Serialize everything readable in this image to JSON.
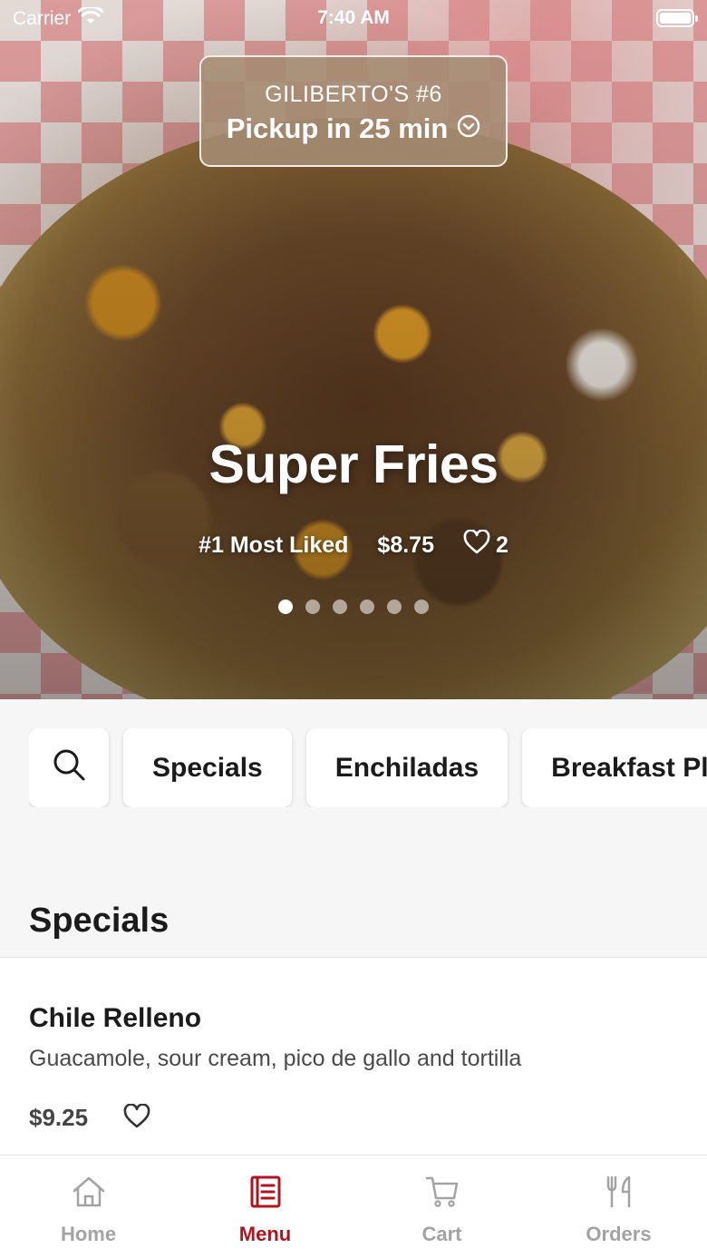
{
  "colors": {
    "accent": "#b0151e",
    "inactive_tab": "#a3a3a3",
    "background": "#f6f6f6"
  },
  "status_bar": {
    "carrier": "Carrier",
    "time": "7:40 AM",
    "wifi_icon": "wifi-icon",
    "battery_icon": "battery-icon"
  },
  "pickup": {
    "store": "GILIBERTO'S #6",
    "time_label": "Pickup in 25 min",
    "icon": "chevron-down-circle-icon"
  },
  "hero": {
    "title": "Super Fries",
    "rank": "#1 Most Liked",
    "price": "$8.75",
    "likes": "2",
    "slide_count": 6,
    "active_slide": 1
  },
  "categories": {
    "search_icon": "search-icon",
    "items": [
      "Specials",
      "Enchiladas",
      "Breakfast Pl"
    ]
  },
  "section": {
    "title": "Specials"
  },
  "menu_items": [
    {
      "name": "Chile Relleno",
      "description": "Guacamole, sour cream, pico de gallo and tortilla",
      "price": "$9.25"
    }
  ],
  "tabbar": {
    "tabs": [
      {
        "label": "Home",
        "icon": "home-icon"
      },
      {
        "label": "Menu",
        "icon": "menu-icon"
      },
      {
        "label": "Cart",
        "icon": "cart-icon"
      },
      {
        "label": "Orders",
        "icon": "fork-knife-icon"
      }
    ],
    "active": "Menu"
  }
}
